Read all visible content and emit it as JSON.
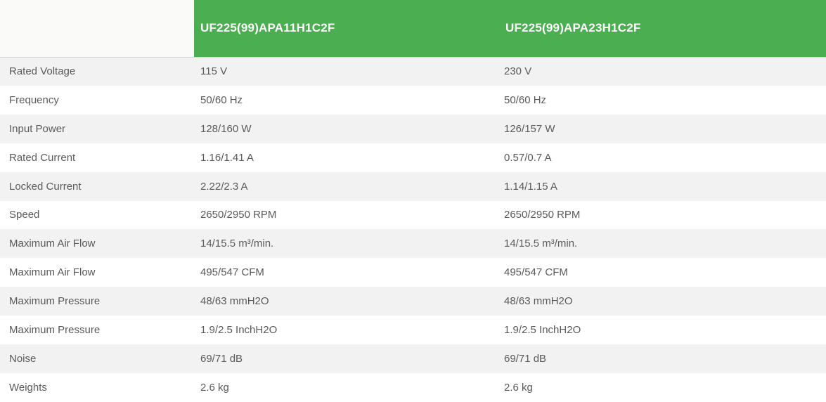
{
  "table": {
    "columns": [
      "",
      "UF225(99)APA11H1C2F",
      "UF225(99)APA23H1C2F"
    ],
    "rows": [
      {
        "label": "Rated Voltage",
        "values": [
          "115 V",
          "230 V"
        ]
      },
      {
        "label": "Frequency",
        "values": [
          "50/60 Hz",
          "50/60 Hz"
        ]
      },
      {
        "label": "Input Power",
        "values": [
          "128/160 W",
          "126/157 W"
        ]
      },
      {
        "label": "Rated Current",
        "values": [
          "1.16/1.41 A",
          "0.57/0.7 A"
        ]
      },
      {
        "label": "Locked Current",
        "values": [
          "2.22/2.3 A",
          "1.14/1.15 A"
        ]
      },
      {
        "label": "Speed",
        "values": [
          "2650/2950 RPM",
          "2650/2950 RPM"
        ]
      },
      {
        "label": "Maximum Air Flow",
        "values": [
          "14/15.5 m³/min.",
          "14/15.5 m³/min."
        ]
      },
      {
        "label": "Maximum Air Flow",
        "values": [
          "495/547 CFM",
          "495/547 CFM"
        ]
      },
      {
        "label": "Maximum Pressure",
        "values": [
          "48/63 mmH2O",
          "48/63 mmH2O"
        ]
      },
      {
        "label": "Maximum Pressure",
        "values": [
          "1.9/2.5 InchH2O",
          "1.9/2.5 InchH2O"
        ]
      },
      {
        "label": "Noise",
        "values": [
          "69/71 dB",
          "69/71 dB"
        ]
      },
      {
        "label": "Weights",
        "values": [
          "2.6 kg",
          "2.6 kg"
        ]
      }
    ],
    "colors": {
      "header_bg": "#4bae50",
      "header_text": "#ffffff",
      "row_alt_bg": "#f2f2f2",
      "row_bg": "#ffffff",
      "body_text": "#595a5c",
      "top_border": "#d5d5d5",
      "blank_header_bg": "#fafaf9"
    }
  }
}
